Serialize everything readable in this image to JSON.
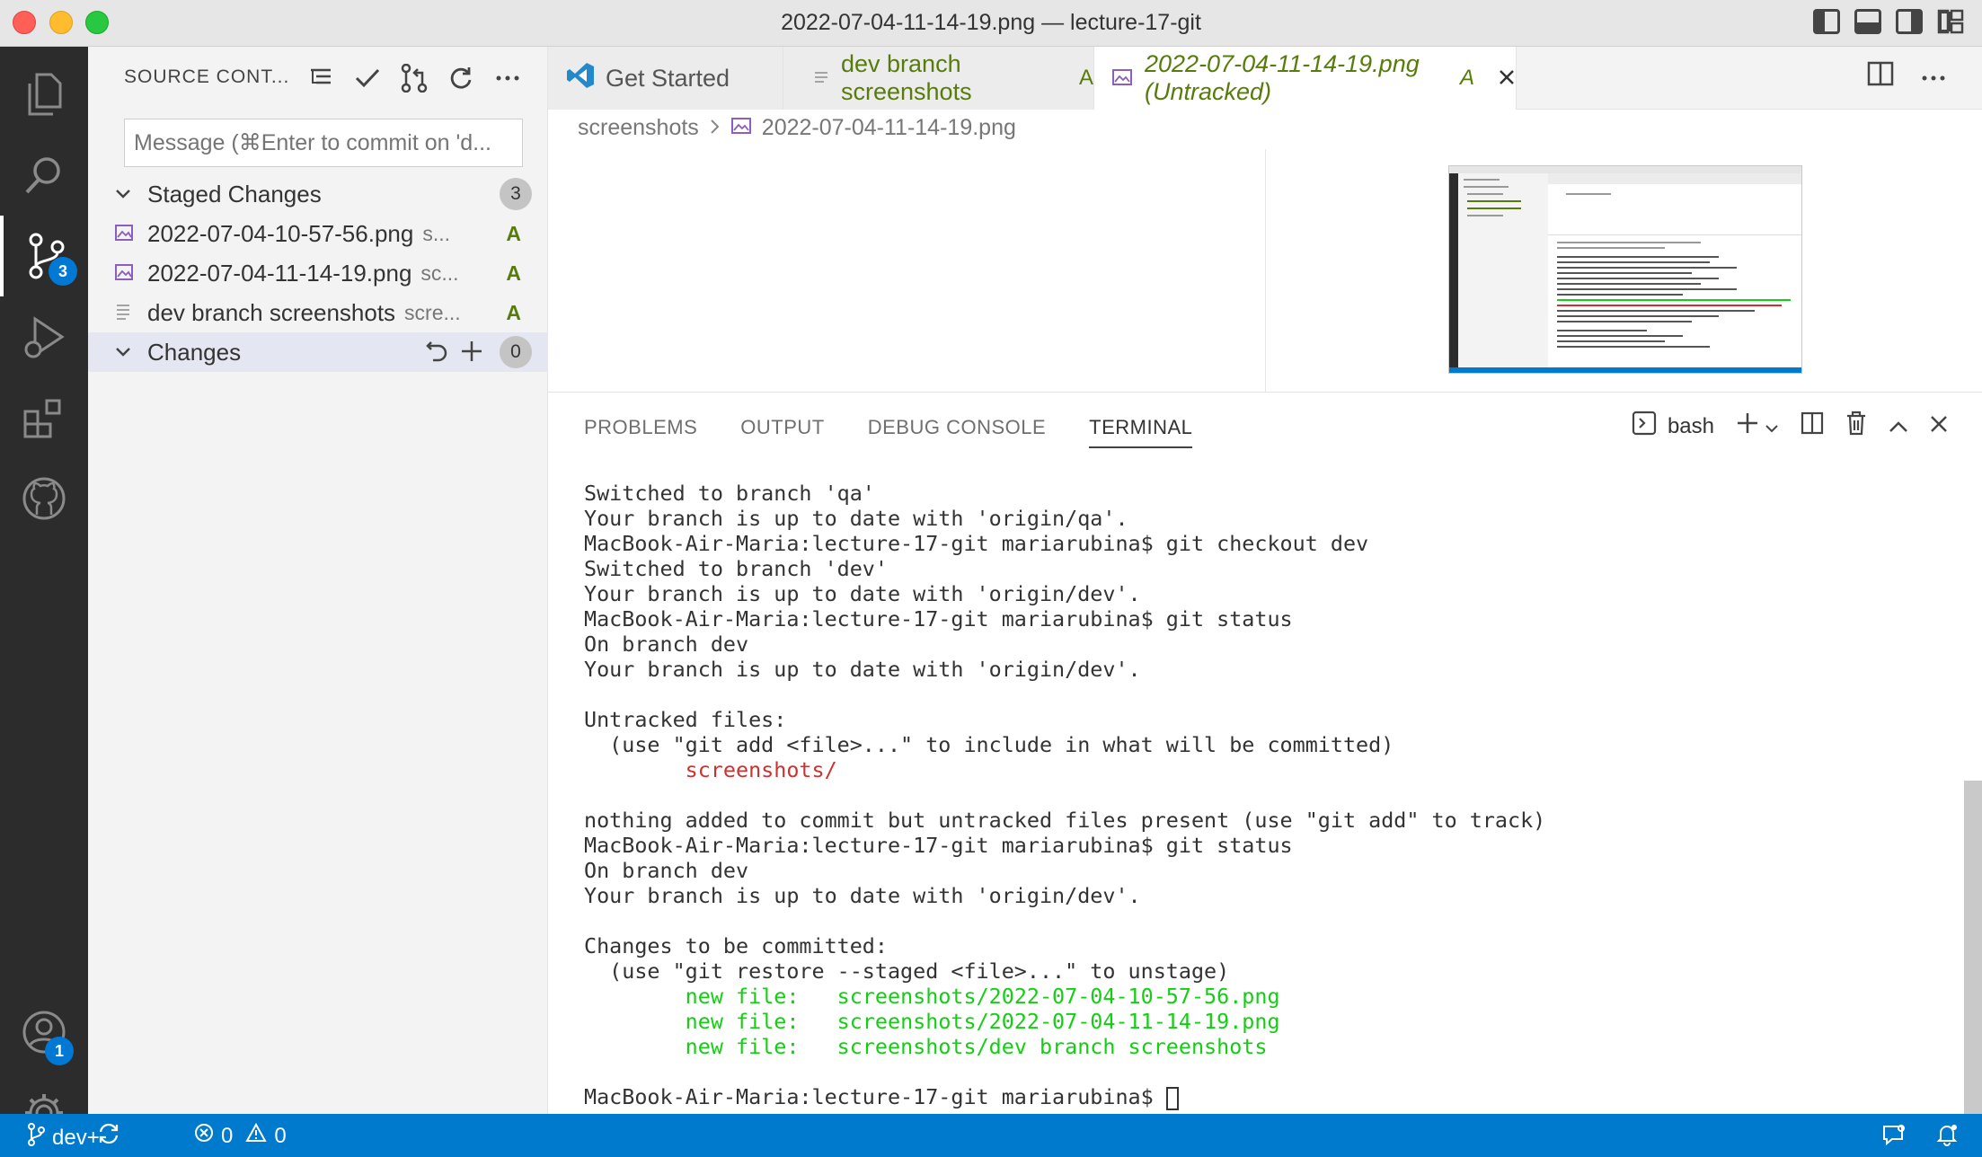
{
  "window": {
    "title": "2022-07-04-11-14-19.png — lecture-17-git"
  },
  "activity_bar": {
    "scm_badge": "3",
    "accounts_badge": "1"
  },
  "sidebar": {
    "title": "SOURCE CONT...",
    "message_placeholder": "Message (⌘Enter to commit on 'd...",
    "staged": {
      "label": "Staged Changes",
      "count": "3",
      "items": [
        {
          "name": "2022-07-04-10-57-56.png",
          "desc": "s...",
          "status": "A"
        },
        {
          "name": "2022-07-04-11-14-19.png",
          "desc": "sc...",
          "status": "A"
        },
        {
          "name": "dev branch screenshots",
          "desc": "scre...",
          "status": "A"
        }
      ]
    },
    "changes": {
      "label": "Changes",
      "count": "0"
    }
  },
  "tabs": [
    {
      "label": "Get Started",
      "status": ""
    },
    {
      "label": "dev branch screenshots",
      "status": "A"
    },
    {
      "label": "2022-07-04-11-14-19.png (Untracked)",
      "status": "A"
    }
  ],
  "breadcrumb": {
    "folder": "screenshots",
    "file": "2022-07-04-11-14-19.png"
  },
  "panel": {
    "tabs": [
      "PROBLEMS",
      "OUTPUT",
      "DEBUG CONSOLE",
      "TERMINAL"
    ],
    "shell": "bash"
  },
  "terminal": {
    "lines": [
      "Switched to branch 'qa'",
      "Your branch is up to date with 'origin/qa'.",
      "MacBook-Air-Maria:lecture-17-git mariarubina$ git checkout dev",
      "Switched to branch 'dev'",
      "Your branch is up to date with 'origin/dev'.",
      "MacBook-Air-Maria:lecture-17-git mariarubina$ git status",
      "On branch dev",
      "Your branch is up to date with 'origin/dev'.",
      "",
      "Untracked files:",
      "  (use \"git add <file>...\" to include in what will be committed)",
      "        screenshots/",
      "",
      "nothing added to commit but untracked files present (use \"git add\" to track)",
      "MacBook-Air-Maria:lecture-17-git mariarubina$ git status",
      "On branch dev",
      "Your branch is up to date with 'origin/dev'.",
      "",
      "Changes to be committed:",
      "  (use \"git restore --staged <file>...\" to unstage)",
      "        new file:   screenshots/2022-07-04-10-57-56.png",
      "        new file:   screenshots/2022-07-04-11-14-19.png",
      "        new file:   screenshots/dev branch screenshots",
      "",
      "MacBook-Air-Maria:lecture-17-git mariarubina$ "
    ],
    "red_lines": [
      11
    ],
    "green_lines": [
      20,
      21,
      22
    ],
    "cursor_line": 24
  },
  "statusbar": {
    "branch": "dev+",
    "errors": "0",
    "warnings": "0"
  },
  "colors": {
    "accent": "#007acc",
    "badge": "#0078d4",
    "added": "#587c0c",
    "terminal_red": "#cd3131",
    "terminal_green": "#14ce14"
  }
}
